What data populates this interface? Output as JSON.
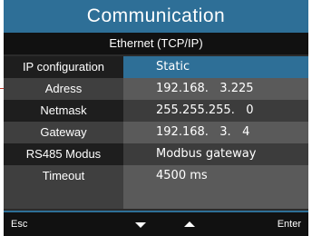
{
  "title": "Communication",
  "subtitle": "Ethernet (TCP/IP)",
  "rows": [
    {
      "label": "IP configuration",
      "value": "Static"
    },
    {
      "label": "Adress",
      "value": "192.168.   3.225"
    },
    {
      "label": "Netmask",
      "value": "255.255.255.   0"
    },
    {
      "label": "Gateway",
      "value": "192.168.   3.   4"
    },
    {
      "label": "RS485 Modus",
      "value": "Modbus gateway"
    },
    {
      "label": "Timeout",
      "value": "4500 ms"
    }
  ],
  "footer": {
    "esc_label": "Esc",
    "enter_label": "Enter",
    "down_icon": "triangle-down-icon",
    "up_icon": "triangle-up-icon"
  },
  "colors": {
    "accent": "#2e6f97",
    "background": "#2b2b2b",
    "pointer": "#c0392b"
  }
}
